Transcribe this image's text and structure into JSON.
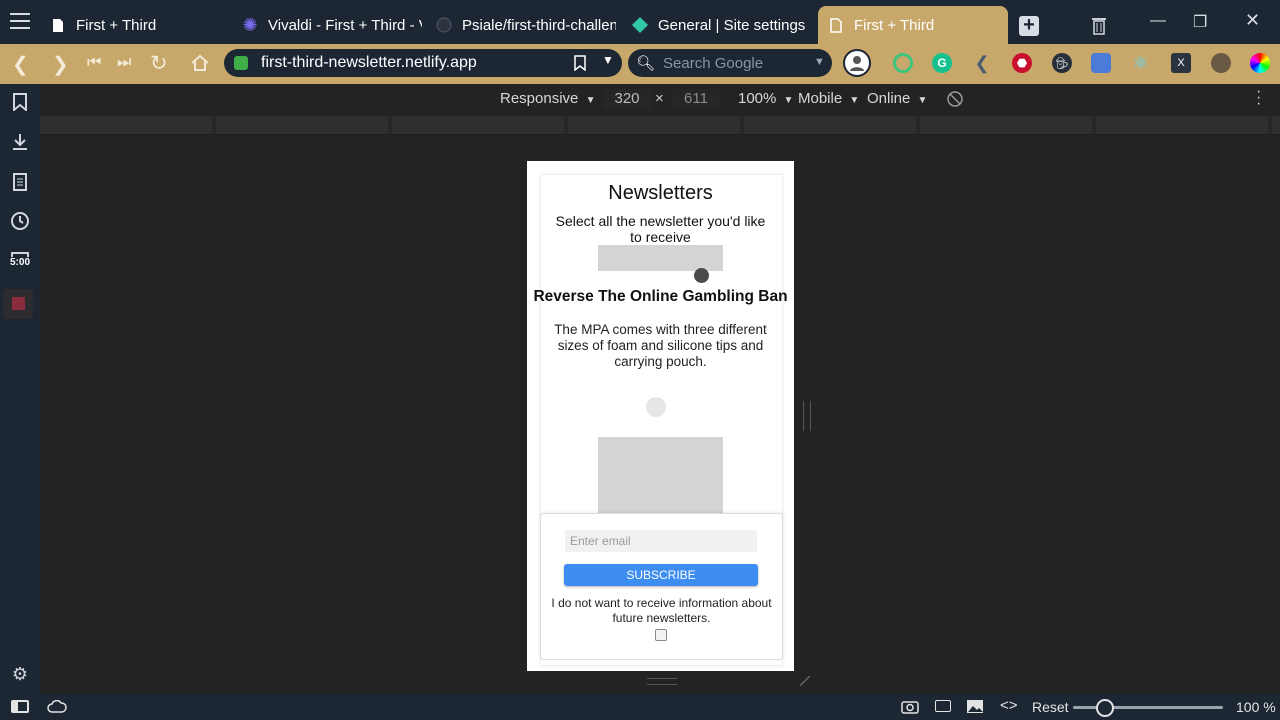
{
  "tabs": [
    {
      "title": "First + Third",
      "icon": "page-icon"
    },
    {
      "title": "Vivaldi - First + Third - Vi",
      "icon": "vivaldi-icon"
    },
    {
      "title": "Psiale/first-third-challeng",
      "icon": "github-icon"
    },
    {
      "title": "General | Site settings",
      "icon": "netlify-icon"
    },
    {
      "title": "First + Third",
      "icon": "page-icon",
      "active": true
    }
  ],
  "address": {
    "url": "first-third-newsletter.netlify.app",
    "search_placeholder": "Search Google"
  },
  "panel": {
    "clock": "5:00"
  },
  "devtools": {
    "mode": "Responsive",
    "width": "320",
    "times": "×",
    "height": "611",
    "zoom": "100%",
    "device": "Mobile",
    "network": "Online"
  },
  "page": {
    "title": "Newsletters",
    "subtitle": "Select all the newsletter you'd like to receive",
    "item_title": "Reverse The Online Gambling Ban",
    "item_desc": "The MPA comes with three different sizes of foam and silicone tips and carrying pouch.",
    "email_placeholder": "Enter email",
    "subscribe_label": "SUBSCRIBE",
    "optout_text": "I do not want to receive information about future newsletters."
  },
  "statusbar": {
    "reset": "Reset",
    "zoom": "100 %"
  },
  "colors": {
    "accent": "#c7a86a",
    "chrome": "#1c2733",
    "subscribe": "#3d8ef0"
  }
}
